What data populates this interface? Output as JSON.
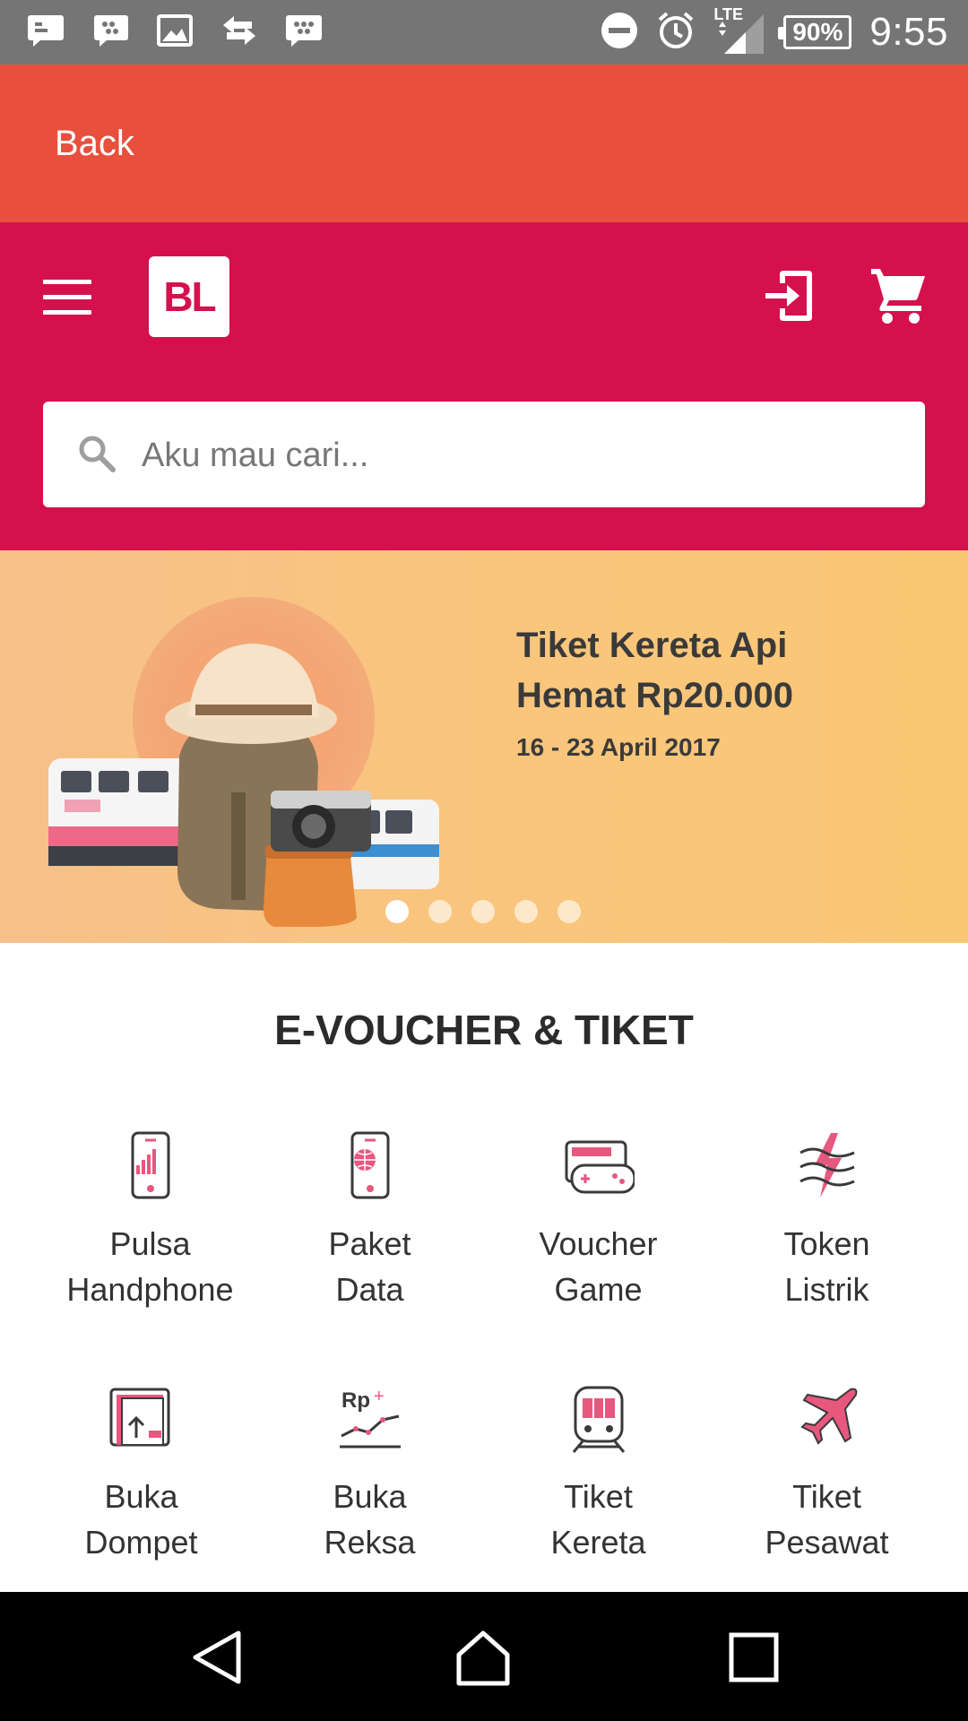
{
  "status_bar": {
    "time": "9:55",
    "battery": "90%",
    "network": "LTE",
    "left_icons": [
      "message-icon",
      "bbm-chat-icon",
      "image-icon",
      "transfer-icon",
      "bbm-icon"
    ],
    "right_icons": [
      "do-not-disturb-icon",
      "alarm-icon",
      "signal-icon",
      "battery-icon"
    ]
  },
  "back_bar": {
    "label": "Back"
  },
  "app_bar": {
    "logo_text": "BL",
    "icons": [
      "menu-icon",
      "login-icon",
      "cart-icon"
    ]
  },
  "search": {
    "placeholder": "Aku mau cari..."
  },
  "banner": {
    "title_line1": "Tiket Kereta Api",
    "title_line2": "Hemat Rp20.000",
    "date": "16 - 23 April 2017",
    "dots_total": 5,
    "active_dot": 1
  },
  "section": {
    "title": "E-VOUCHER & TIKET",
    "items": [
      {
        "line1": "Pulsa",
        "line2": "Handphone",
        "icon": "phone-signal-icon"
      },
      {
        "line1": "Paket",
        "line2": "Data",
        "icon": "phone-globe-icon"
      },
      {
        "line1": "Voucher",
        "line2": "Game",
        "icon": "game-voucher-icon"
      },
      {
        "line1": "Token",
        "line2": "Listrik",
        "icon": "electricity-icon"
      },
      {
        "line1": "Buka",
        "line2": "Dompet",
        "icon": "wallet-icon"
      },
      {
        "line1": "Buka",
        "line2": "Reksa",
        "icon": "mutual-fund-icon"
      },
      {
        "line1": "Tiket",
        "line2": "Kereta",
        "icon": "train-icon"
      },
      {
        "line1": "Tiket",
        "line2": "Pesawat",
        "icon": "airplane-icon"
      }
    ]
  },
  "colors": {
    "status_bar": "#757575",
    "back_bar": "#e84f3d",
    "app_bar": "#d5114d",
    "accent_pink": "#e8577e",
    "nav_bar": "#000000"
  },
  "nav_bar": {
    "icons": [
      "back-triangle-icon",
      "home-icon",
      "recents-icon"
    ]
  }
}
